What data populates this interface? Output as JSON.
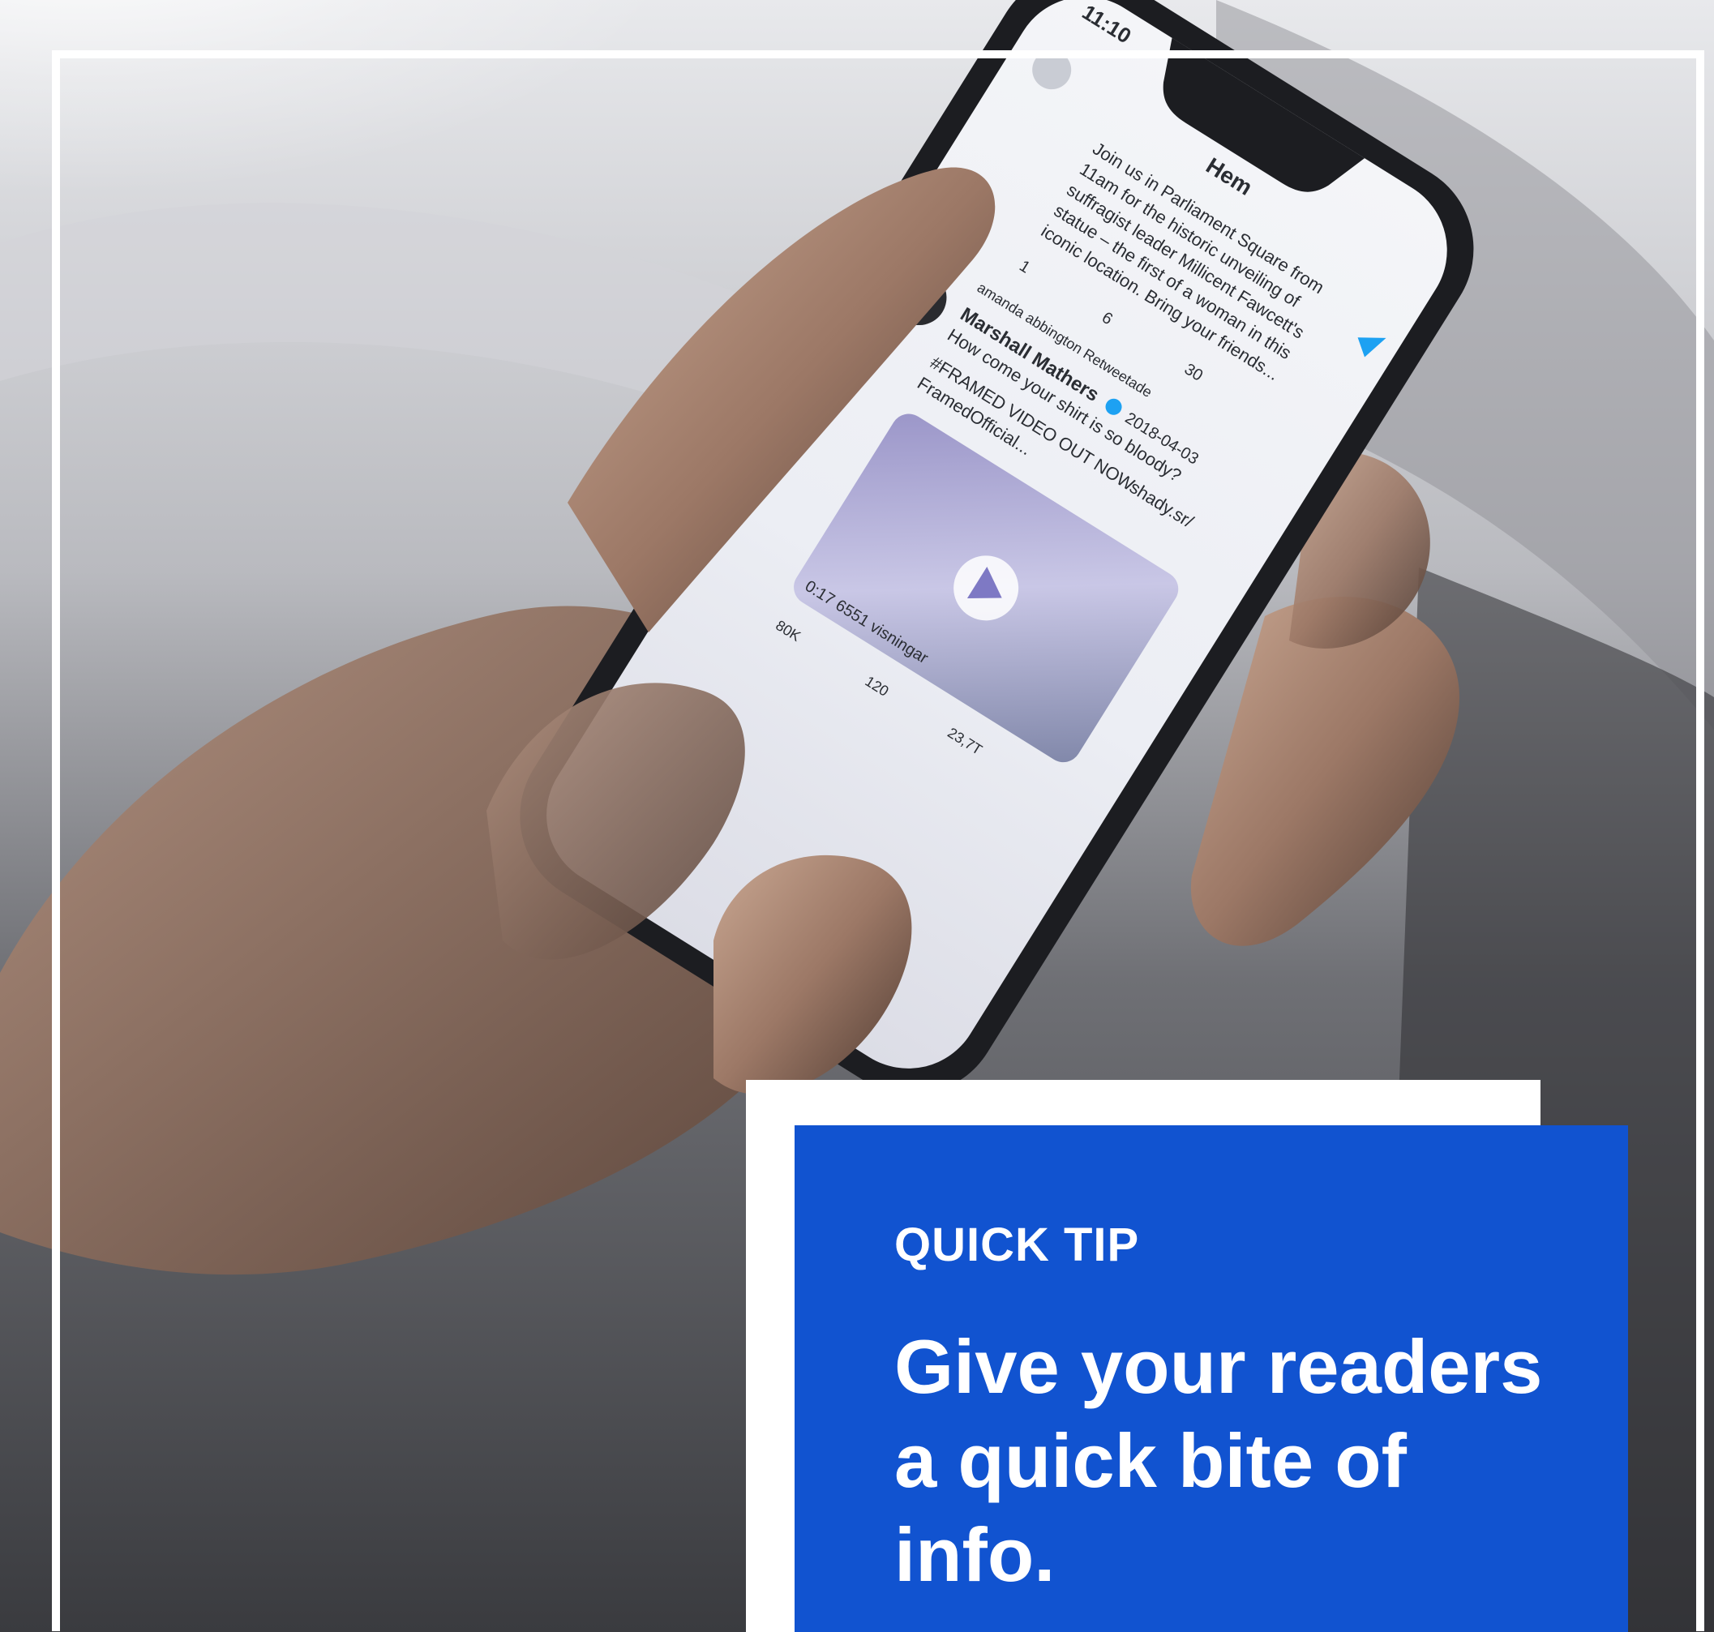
{
  "phone_screen": {
    "status_time": "11:10",
    "header_title": "Hem",
    "tweet1": {
      "lines": [
        "Join us in Parliament Square from",
        "11am for the historic unveiling of",
        "suffragist leader Millicent Fawcett's",
        "statue – the first of a woman in this",
        "iconic location. Bring your friends..."
      ],
      "reply_count": "1",
      "retweet_count": "6",
      "like_count": "30"
    },
    "tweet2": {
      "retweeted_by": "amanda abbington Retweetade",
      "author": "Marshall Mathers",
      "date": "2018-04-03",
      "text": "How come your shirt is so bloody?",
      "hashtag_line": "#FRAMED VIDEO OUT NOW",
      "link": "shady.sr/",
      "mention": "FramedOfficial...",
      "views": "0:17 6551 visningar",
      "reply_count": "80K",
      "retweet_count": "120",
      "like_count": "23,7T"
    }
  },
  "tip_card": {
    "eyebrow": "QUICK TIP",
    "headline": "Give your readers a quick bite of info."
  },
  "colors": {
    "accent_blue": "#1153d0",
    "card_white": "#ffffff",
    "twitter_blue": "#1da1f2"
  }
}
